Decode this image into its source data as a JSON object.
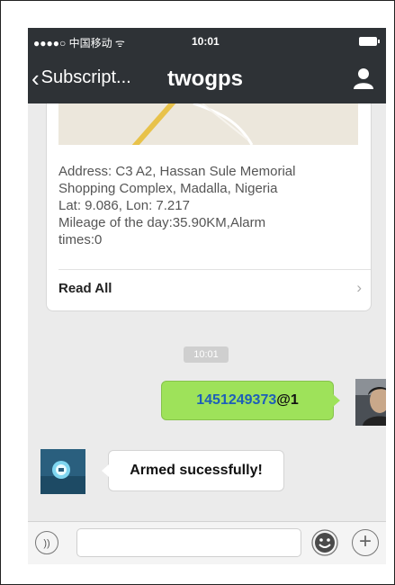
{
  "status_bar": {
    "carrier": "●●●●○ 中国移动 ᯤ",
    "time": "10:01"
  },
  "navbar": {
    "back_label": "Subscript...",
    "title": "twogps"
  },
  "card": {
    "address_lines": [
      "Address: C3 A2, Hassan Sule Memorial",
      "Shopping Complex, Madalla, Nigeria",
      "Lat: 9.086, Lon: 7.217",
      "Mileage of the day:35.90KM,Alarm",
      "times:0"
    ],
    "read_all_label": "Read All",
    "arrow": "›"
  },
  "chat": {
    "timestamp": "10:01",
    "outgoing": {
      "number": "1451249373",
      "suffix": "@1"
    },
    "incoming": {
      "text": "Armed sucessfully!"
    }
  },
  "input_bar": {
    "voice_symbol": "))",
    "message_placeholder": "",
    "plus_symbol": "+"
  },
  "colors": {
    "nav_bg": "#2e3236",
    "outgoing_bubble": "#9ee25a",
    "chat_bg": "#ebebeb"
  }
}
